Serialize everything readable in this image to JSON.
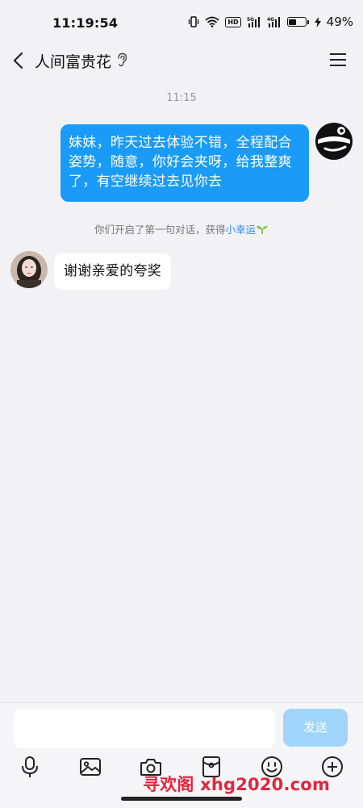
{
  "status_bar": {
    "time": "11:19:54",
    "hd_label": "HD",
    "battery_percent": "49%",
    "battery_level": 0.49
  },
  "header": {
    "title": "人间富贵花"
  },
  "conversation": {
    "timestamp": "11:15",
    "outgoing_message": "妹妹，昨天过去体验不错，全程配合姿势，随意，你好会夹呀，给我整爽了，有空继续过去见你去",
    "system_notice_prefix": "你们开启了第一句对话，获得",
    "system_notice_link": "小幸运",
    "incoming_message": "谢谢亲爱的夸奖"
  },
  "composer": {
    "input_value": "",
    "send_label": "发送"
  },
  "watermark": "寻欢阁 xhg2020.com",
  "colors": {
    "outgoing_bubble": "#1a9bf7",
    "send_button_disabled": "#9fd4fb",
    "link": "#2f86f6",
    "watermark": "#e2263d"
  },
  "icons": {
    "toolbar": [
      "microphone-icon",
      "image-icon",
      "camera-icon",
      "red-envelope-icon",
      "emoji-icon",
      "plus-icon"
    ]
  }
}
